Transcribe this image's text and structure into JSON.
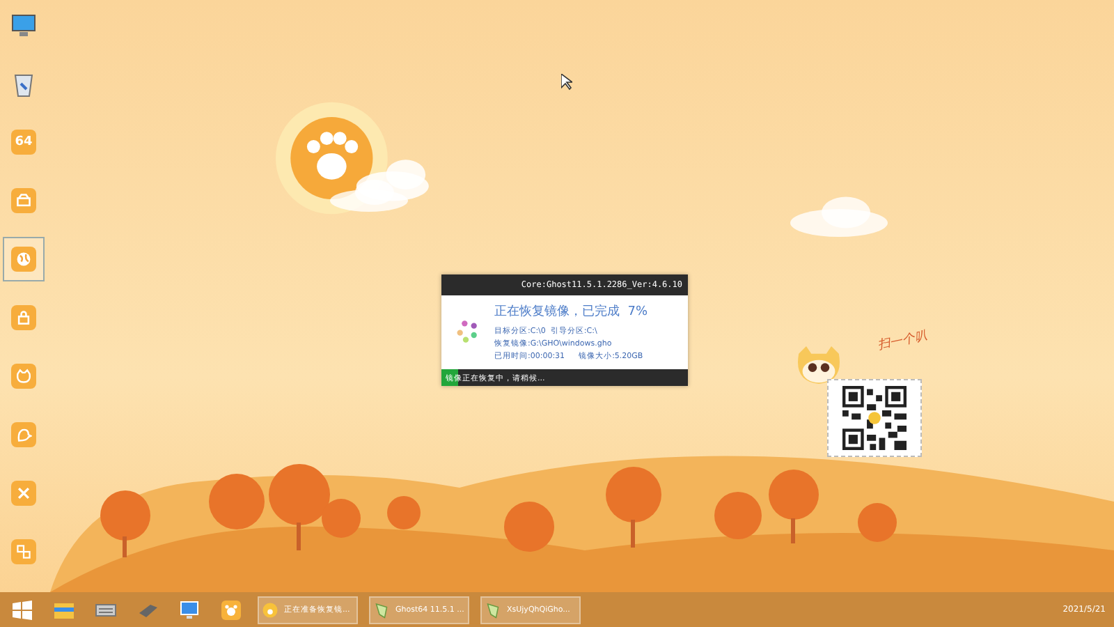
{
  "desktop_icons": [
    {
      "kind": "monitor",
      "selected": false
    },
    {
      "kind": "recycle-bin",
      "selected": false
    },
    {
      "kind": "tile-text",
      "text": "64",
      "selected": false
    },
    {
      "kind": "tile-drive",
      "selected": false
    },
    {
      "kind": "tile-globe",
      "selected": true
    },
    {
      "kind": "tile-lock",
      "selected": false
    },
    {
      "kind": "tile-cat",
      "selected": false
    },
    {
      "kind": "tile-bird",
      "selected": false
    },
    {
      "kind": "tile-tools",
      "selected": false
    },
    {
      "kind": "tile-window",
      "selected": false
    }
  ],
  "dialog": {
    "title": "Core:Ghost11.5.1.2286_Ver:4.6.10",
    "heading": "正在恢复镜像，已完成  7%",
    "lines": [
      "目标分区:C:\\0  引导分区:C:\\",
      "恢复镜像:G:\\GHO\\windows.gho"
    ],
    "elapsed": "已用时间:00:00:31",
    "size": "镜像大小:5.20GB",
    "status": "镜像正在恢复中，请稍候...",
    "level": 0.07
  },
  "sticker": {
    "caption": "扫一个叭"
  },
  "taskbar": {
    "pinned": [
      {
        "kind": "start"
      },
      {
        "kind": "explorer"
      },
      {
        "kind": "keyboard"
      },
      {
        "kind": "drive"
      },
      {
        "kind": "network"
      },
      {
        "kind": "paw"
      }
    ],
    "tasks": [
      {
        "kind": "paw",
        "label": "正在准备恢复镜..."
      },
      {
        "kind": "ghost",
        "label": "Ghost64 11.5.1 ..."
      },
      {
        "kind": "ghost",
        "label": "XsUjyQhQiGho..."
      }
    ],
    "date": "2021/5/21"
  }
}
